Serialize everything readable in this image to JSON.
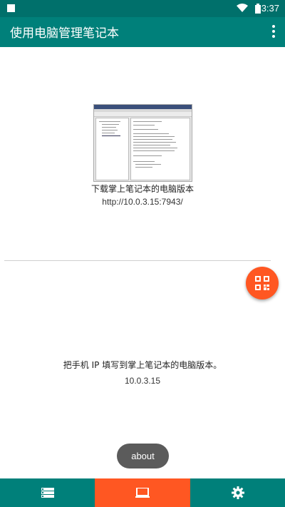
{
  "status_bar": {
    "time": "3:37",
    "icons": [
      "notification-square-icon",
      "wifi-icon",
      "battery-icon"
    ]
  },
  "toolbar": {
    "title": "使用电脑管理笔记本",
    "menu_icon": "more-vert-icon"
  },
  "desktop_section": {
    "caption": "下载掌上笔记本的电脑版本",
    "url": "http://10.0.3.15:7943/"
  },
  "fab": {
    "icon": "qr-code-icon",
    "color": "#ff5722"
  },
  "ip_section": {
    "caption": "把手机 IP 填写到掌上笔记本的电脑版本。",
    "ip": "10.0.3.15"
  },
  "about_button": {
    "label": "about"
  },
  "bottom_nav": {
    "items": [
      {
        "icon": "list-icon",
        "selected": false
      },
      {
        "icon": "laptop-icon",
        "selected": true
      },
      {
        "icon": "settings-gear-icon",
        "selected": false
      }
    ],
    "accent": "#ff5722",
    "background": "#00807a"
  }
}
